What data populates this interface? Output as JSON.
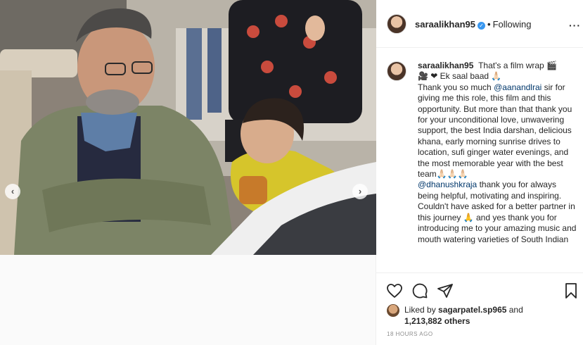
{
  "header": {
    "username": "saraalikhan95",
    "verified_glyph": "✓",
    "separator": "•",
    "follow_status": "Following",
    "more_label": "···"
  },
  "caption": {
    "username": "saraalikhan95",
    "line1": "That's a film wrap 🎬",
    "line2": "🎥 ❤ Ek saal baad 🙏🏻",
    "p1_a": "Thank you so much ",
    "mention1": "@aanandlrai",
    "p1_b": " sir for giving me this role, this film and this opportunity. But more than that thank you for your unconditional love, unwavering support, the best India darshan, delicious khana, early morning sunrise drives to location, sufi ginger water evenings, and the most memorable year with the best team🙏🏻🙏🏻🙏🏻",
    "mention2": "@dhanushkraja",
    "p2": " thank you for always being helpful, motivating and inspiring. Couldn't have asked for a better partner in this journey 🙏 and yes thank you for introducing me to your amazing music and mouth watering varieties of South Indian"
  },
  "media": {
    "prev_glyph": "‹",
    "next_glyph": "›"
  },
  "actions": {
    "like_icon": "heart-icon",
    "comment_icon": "comment-icon",
    "share_icon": "share-icon",
    "save_icon": "bookmark-icon"
  },
  "likes": {
    "prefix": "Liked by ",
    "user": "sagarpatel.sp965",
    "middle": " and ",
    "count": "1,213,882 others"
  },
  "timestamp": "18 HOURS AGO",
  "colors": {
    "mention": "#00376b",
    "verified": "#3897f0",
    "text": "#262626",
    "muted": "#8e8e8e"
  }
}
